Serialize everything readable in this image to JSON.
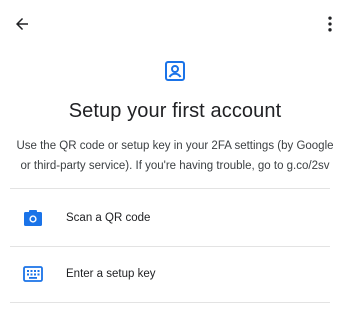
{
  "icons": {
    "back": "arrow-back-icon",
    "more": "more-vert-icon",
    "header": "account-box-icon",
    "qr": "camera-icon",
    "key": "keyboard-icon"
  },
  "colors": {
    "accent": "#1a73e8",
    "text": "#202124",
    "subtext": "#3c4043",
    "divider": "#e3e3e3"
  },
  "page": {
    "title": "Setup your first account",
    "description": "Use the QR code or setup key in your 2FA settings (by Google or third-party service). If you're having trouble, go to g.co/2sv"
  },
  "options": [
    {
      "label": "Scan a QR code"
    },
    {
      "label": "Enter a setup key"
    }
  ]
}
